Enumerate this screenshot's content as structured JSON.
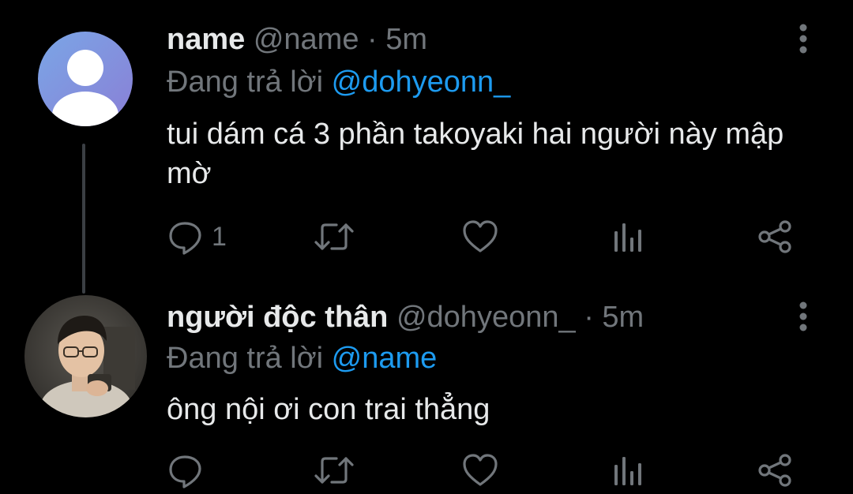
{
  "tweets": [
    {
      "display_name": "name",
      "handle": "@name",
      "separator": "·",
      "time": "5m",
      "reply_prefix": "Đang trả lời",
      "reply_to": "@dohyeonn_",
      "text": "tui dám cá 3 phần takoyaki hai người này mập mờ",
      "reply_count": "1",
      "avatar": "default-avatar"
    },
    {
      "display_name": "người độc thân",
      "handle": "@dohyeonn_",
      "separator": "·",
      "time": "5m",
      "reply_prefix": "Đang trả lời",
      "reply_to": "@name",
      "text": "ông nội ơi con trai thẳng",
      "avatar": "profile-photo"
    }
  ],
  "icons": {
    "reply": "reply-icon",
    "retweet": "retweet-icon",
    "like": "heart-icon",
    "views": "views-icon",
    "share": "share-icon",
    "more": "more-icon"
  },
  "colors": {
    "background": "#000000",
    "text": "#e7e9ea",
    "secondary": "#71767b",
    "accent": "#1d9bf0",
    "thread_line": "#3b3f44"
  }
}
